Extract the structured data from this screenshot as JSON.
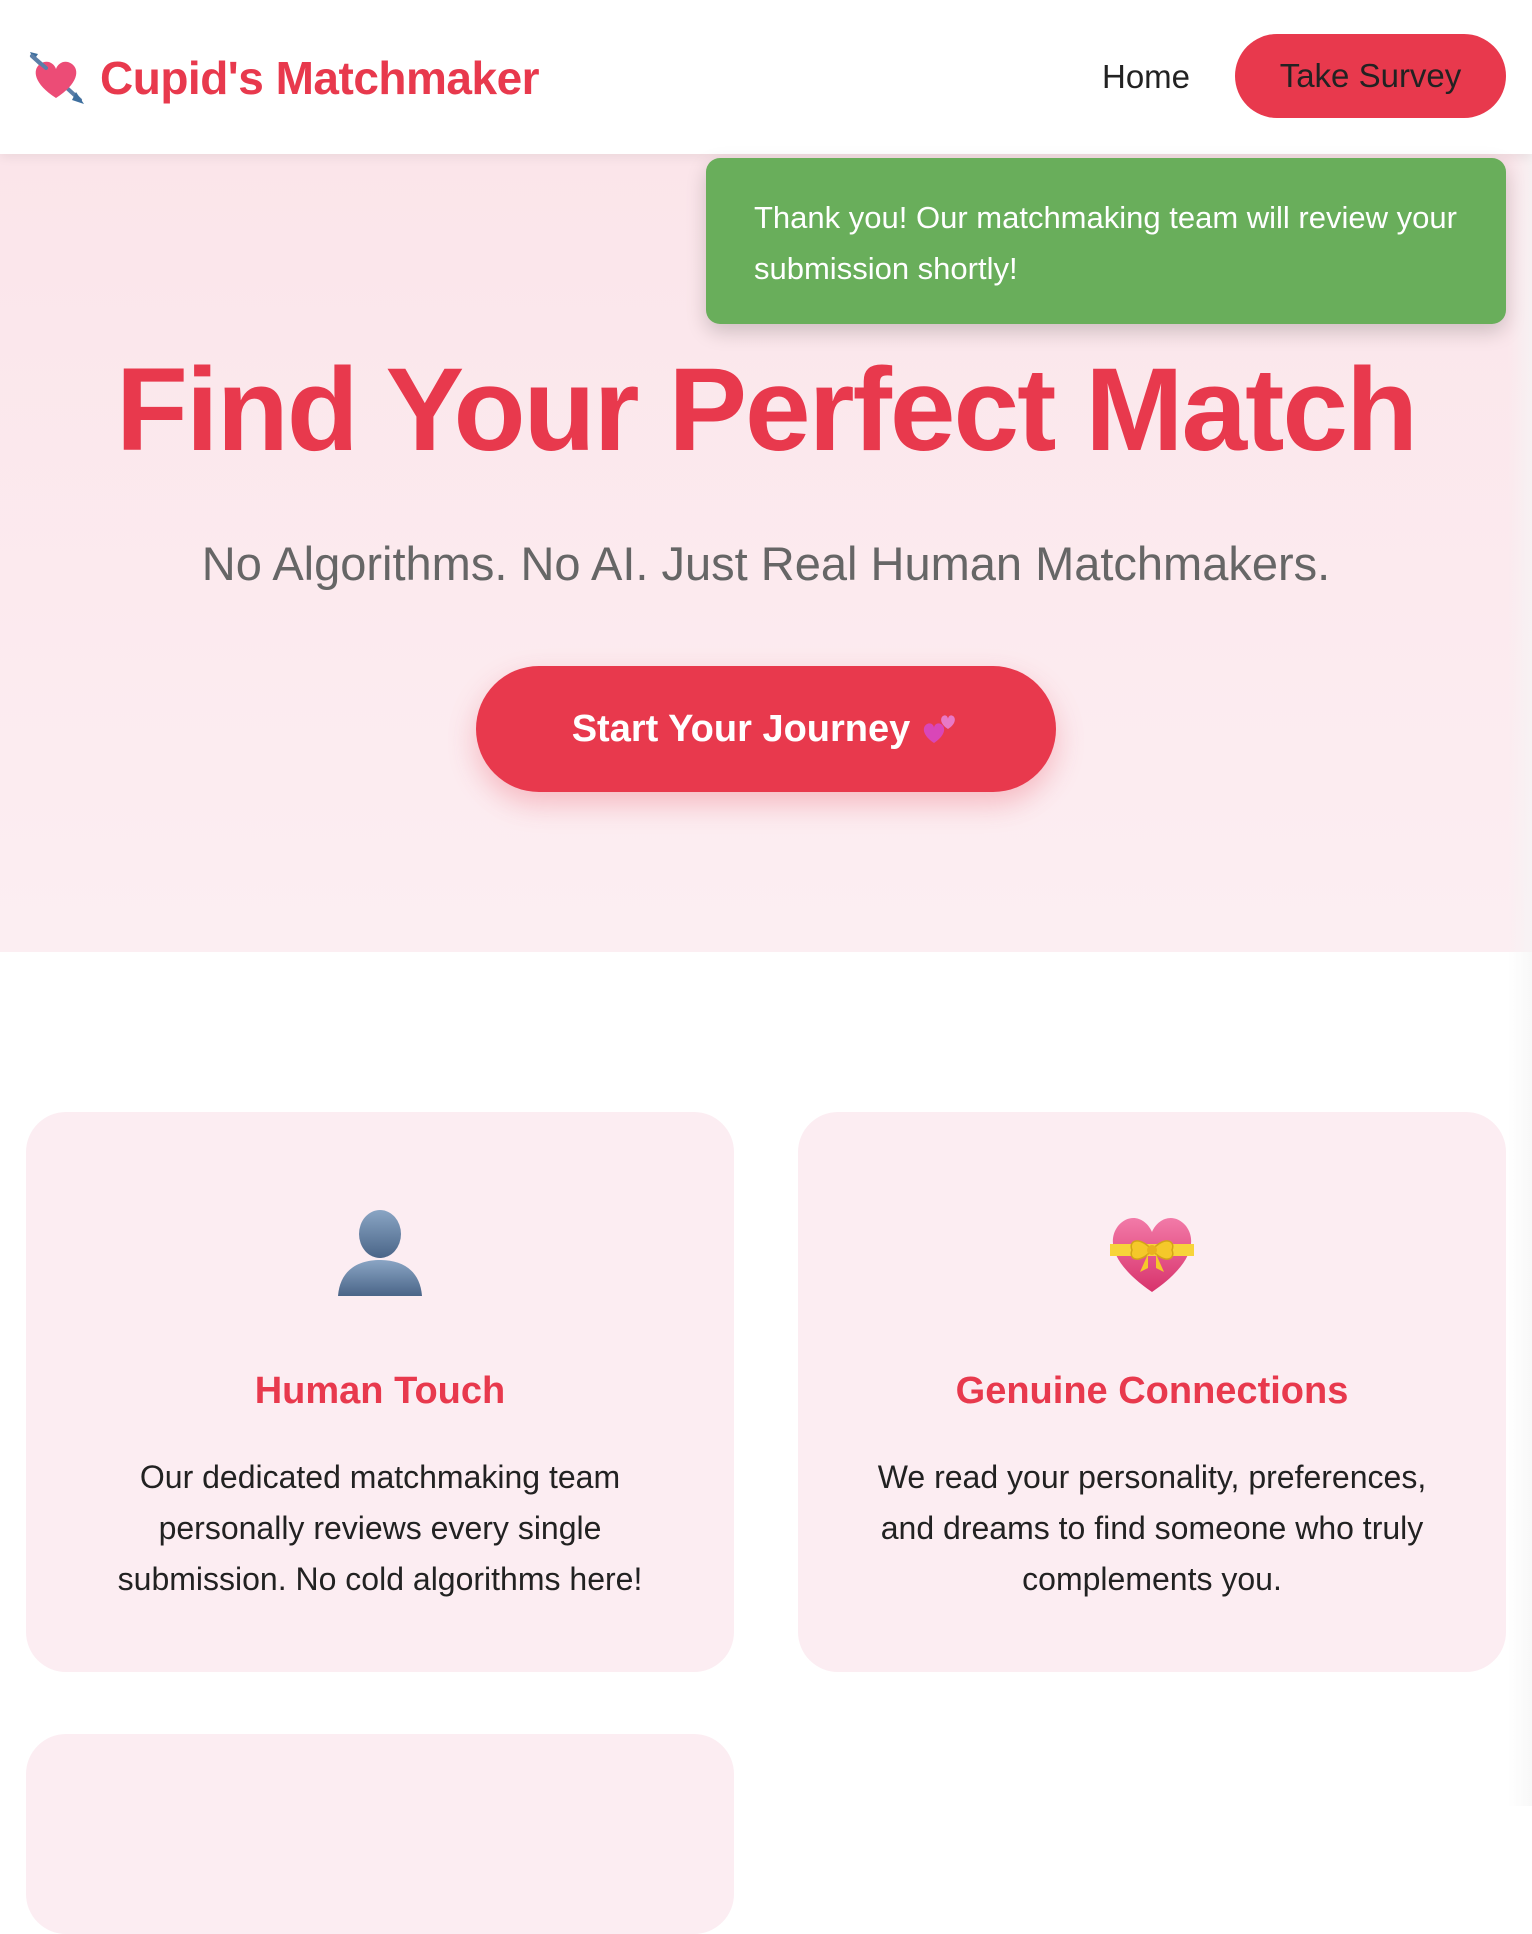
{
  "header": {
    "brand_name": "Cupid's Matchmaker",
    "brand_icon": "heart-with-arrow-icon",
    "nav": {
      "home_label": "Home",
      "survey_label": "Take Survey"
    }
  },
  "toast": {
    "message": "Thank you! Our matchmaking team will review your submission shortly!"
  },
  "hero": {
    "title": "Find Your Perfect Match",
    "subtitle": "No Algorithms. No AI. Just Real Human Matchmakers.",
    "cta_label": "Start Your Journey",
    "cta_icon": "two-hearts-icon"
  },
  "features": [
    {
      "icon": "person-silhouette-icon",
      "title": "Human Touch",
      "text": "Our dedicated matchmaking team personally reviews every single submission. No cold algorithms here!"
    },
    {
      "icon": "heart-with-ribbon-icon",
      "title": "Genuine Connections",
      "text": "We read your personality, preferences, and dreams to find someone who truly complements you."
    }
  ],
  "colors": {
    "brand": "#e8394d",
    "hero_bg": "#fbe5ea",
    "card_bg": "#fcedf2",
    "toast_bg": "#69ae5b"
  }
}
